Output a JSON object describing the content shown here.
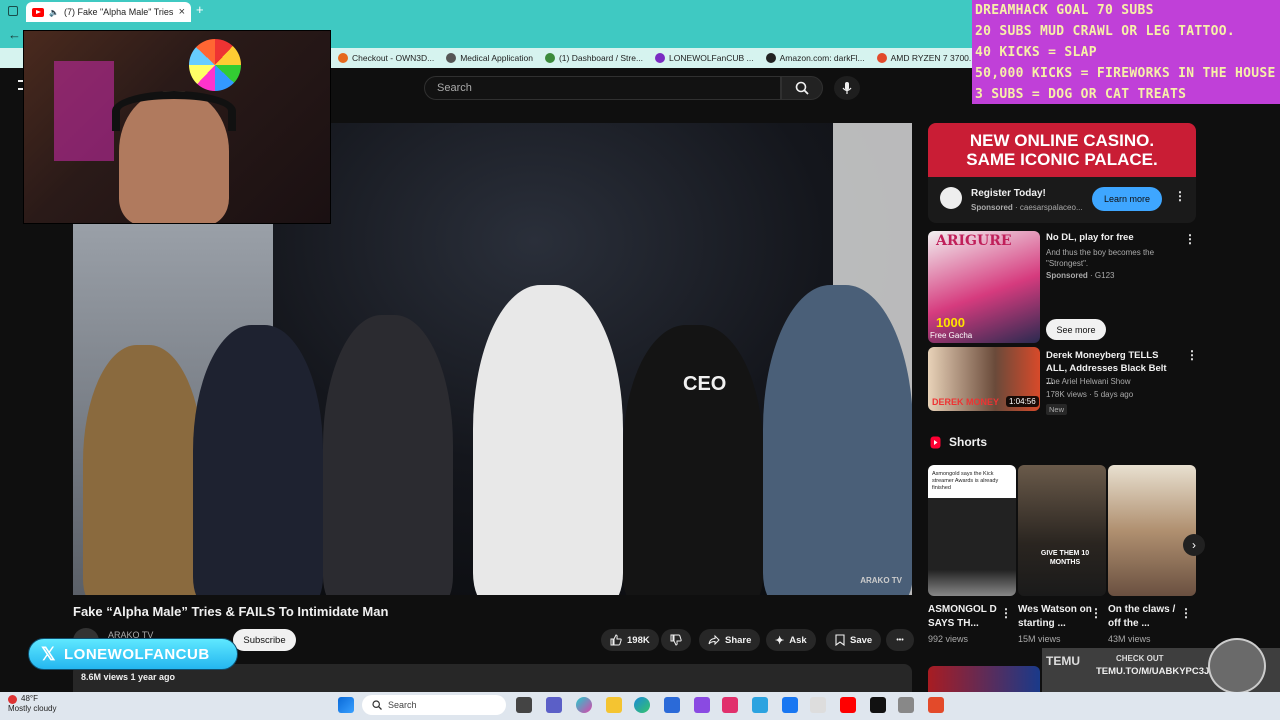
{
  "browser": {
    "tab_title": "(7) Fake \"Alpha Male\" Tries &",
    "tab_close": "×",
    "new_tab": "+",
    "bookmarks": [
      "Checkout - OWN3D...",
      "Medical Application",
      "(1) Dashboard / Stre...",
      "LONEWOLFanCUB ...",
      "Amazon.com: darkFl...",
      "AMD RYZEN 7 3700..."
    ]
  },
  "overlay": {
    "lines": [
      "DREAMHACK GOAL 70 SUBS",
      "20 SUBS MUD CRAWL OR LEG TATTOO.",
      "40 KICKS = SLAP",
      "50,000 KICKS = FIREWORKS IN THE HOUSE",
      "3 SUBS = DOG OR CAT TREATS"
    ]
  },
  "youtube": {
    "search_placeholder": "Search",
    "video_title": "Fake “Alpha Male” Tries & FAILS To Intimidate Man",
    "channel_name": "ARAKO TV",
    "subscribe_label": "Subscribe",
    "likes": "198K",
    "share_label": "Share",
    "ask_label": "Ask",
    "save_label": "Save",
    "more_label": "•••",
    "views_meta": "8.6M views  1 year ago",
    "watermark": "ARAKO TV",
    "x_handle": "LONEWOLFANCUB"
  },
  "sidebar": {
    "ad": {
      "banner_line1": "NEW ONLINE CASINO.",
      "banner_line2": "SAME ICONIC PALACE.",
      "register": "Register Today!",
      "sponsored": "Sponsored",
      "advertiser": "· caesarspalaceo...",
      "cta": "Learn more"
    },
    "ad2": {
      "title": "No DL, play for free",
      "desc": "And thus the boy becomes the \"Strongest\".",
      "sponsored": "Sponsored",
      "advertiser": "· G123",
      "cta": "See more",
      "thumb_text": "ARIGURE",
      "thumb_num": "1000",
      "thumb_sub": "Free Gacha"
    },
    "video1": {
      "title": "Derek Moneyberg TELLS ALL, Addresses Black Belt ...",
      "channel": "The Ariel Helwani Show",
      "meta": "178K views · 5 days ago",
      "badge": "New",
      "duration": "1:04:56",
      "thumb_text": "DEREK MONEY"
    },
    "shorts_heading": "Shorts",
    "shorts": [
      {
        "title": "ASMONGOL D SAYS TH...",
        "views": "992 views"
      },
      {
        "title": "Wes Watson on starting ...",
        "views": "15M views"
      },
      {
        "title": "On the claws / off the ...",
        "views": "43M views"
      }
    ],
    "shorts_thumb_texts": [
      "Asmongold says the Kick streamer Awards is already finished",
      "GIVE THEM 10 MONTHS"
    ]
  },
  "temu": {
    "check_out": "CHECK OUT",
    "url": "TEMU.TO/M/UABKYPC3J2P",
    "logo": "TEMU"
  },
  "taskbar": {
    "temp": "48°F",
    "weather": "Mostly cloudy",
    "search_placeholder": "Search"
  },
  "colors": {
    "chrome_accent": "#3fc9c2",
    "overlay_bg": "#c040d8",
    "overlay_text": "#f7f0a8",
    "youtube_red": "#ff0000",
    "ad_red": "#c91d35",
    "learn_more_blue": "#3ea6ff"
  }
}
